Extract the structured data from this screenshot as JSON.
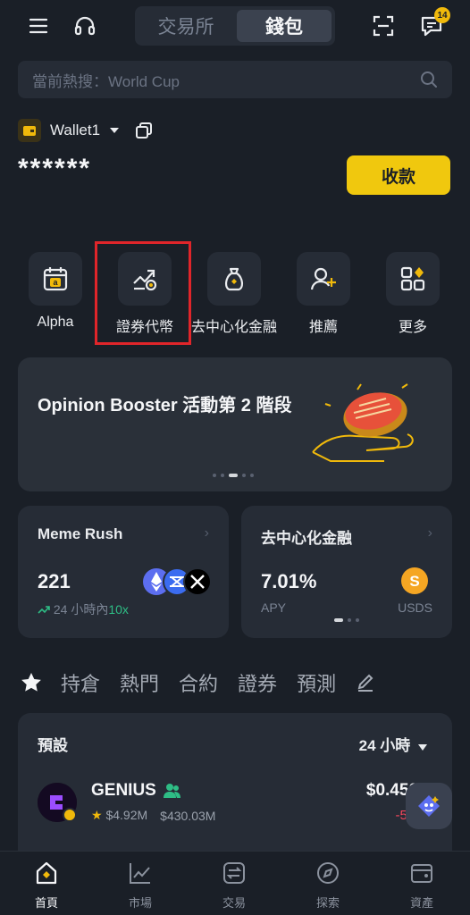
{
  "header": {
    "segments": [
      "交易所",
      "錢包"
    ],
    "active_segment": "錢包",
    "notification_count": "14"
  },
  "search": {
    "placeholder": "當前熱搜：World Cup"
  },
  "wallet": {
    "name": "Wallet1",
    "balance": "******",
    "receive_label": "收款"
  },
  "quick_actions": [
    {
      "label": "Alpha",
      "icon": "alpha-calendar-icon"
    },
    {
      "label": "證券代幣",
      "icon": "securities-token-icon",
      "highlighted": true
    },
    {
      "label": "去中心化金融",
      "icon": "defi-bag-icon"
    },
    {
      "label": "推薦",
      "icon": "add-user-icon"
    },
    {
      "label": "更多",
      "icon": "grid-more-icon"
    }
  ],
  "banner": {
    "title": "Opinion Booster 活動第 2 階段",
    "page_index": 3,
    "page_count": 5
  },
  "cards": {
    "meme": {
      "title": "Meme Rush",
      "value": "221",
      "sub_prefix": "24 小時內",
      "sub_change": "10x"
    },
    "defi": {
      "title": "去中心化金融",
      "value": "7.01%",
      "sub_label": "APY",
      "asset": "USDS"
    }
  },
  "tabs": [
    "持倉",
    "熱門",
    "合約",
    "證券",
    "預測"
  ],
  "list": {
    "header": "預設",
    "range": "24 小時",
    "items": [
      {
        "name": "GENIUS",
        "stat1": "$4.92M",
        "stat2": "$430.03M",
        "price": "$0.450",
        "change": "-5."
      }
    ]
  },
  "nav": [
    {
      "label": "首頁",
      "icon": "home-icon",
      "active": true
    },
    {
      "label": "市場",
      "icon": "market-chart-icon"
    },
    {
      "label": "交易",
      "icon": "trade-icon"
    },
    {
      "label": "探索",
      "icon": "explore-icon"
    },
    {
      "label": "資產",
      "icon": "assets-icon"
    }
  ],
  "colors": {
    "accent": "#f0c80e",
    "background": "#1a1f27",
    "card": "#262c36",
    "negative": "#f6465d",
    "positive": "#2ebd85",
    "highlight_box": "#e0252a"
  }
}
